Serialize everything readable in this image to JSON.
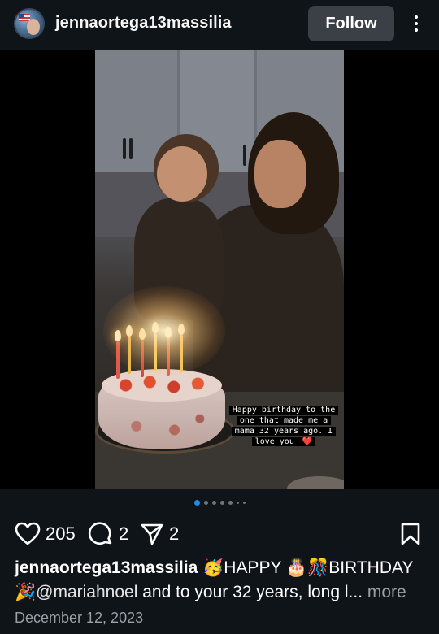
{
  "header": {
    "username": "jennaortega13massilia",
    "follow_label": "Follow",
    "avatar_icon": "profile-avatar",
    "more_icon": "more-vertical-icon"
  },
  "media": {
    "story_caption": "Happy birthday to the one that made me a mama 32 years ago. I love you",
    "story_caption_emoji": "❤️",
    "carousel": {
      "count": 7,
      "active_index": 0
    }
  },
  "actions": {
    "like_count": "205",
    "comment_count": "2",
    "share_count": "2",
    "icons": [
      "heart-icon",
      "comment-icon",
      "share-icon",
      "bookmark-icon"
    ]
  },
  "caption": {
    "username": "jennaortega13massilia",
    "text_part1": " 🥳HAPPY 🎂🎊BIRTHDAY 🎉",
    "mention": "@mariahnoel",
    "text_part2": " and to your 32 years, long l...",
    "more_label": " more"
  },
  "date": "December 12, 2023",
  "colors": {
    "background": "#0f1419",
    "follow_button": "#3b4047",
    "active_dot": "#1d8cf0",
    "muted_text": "#9aa0a6"
  }
}
